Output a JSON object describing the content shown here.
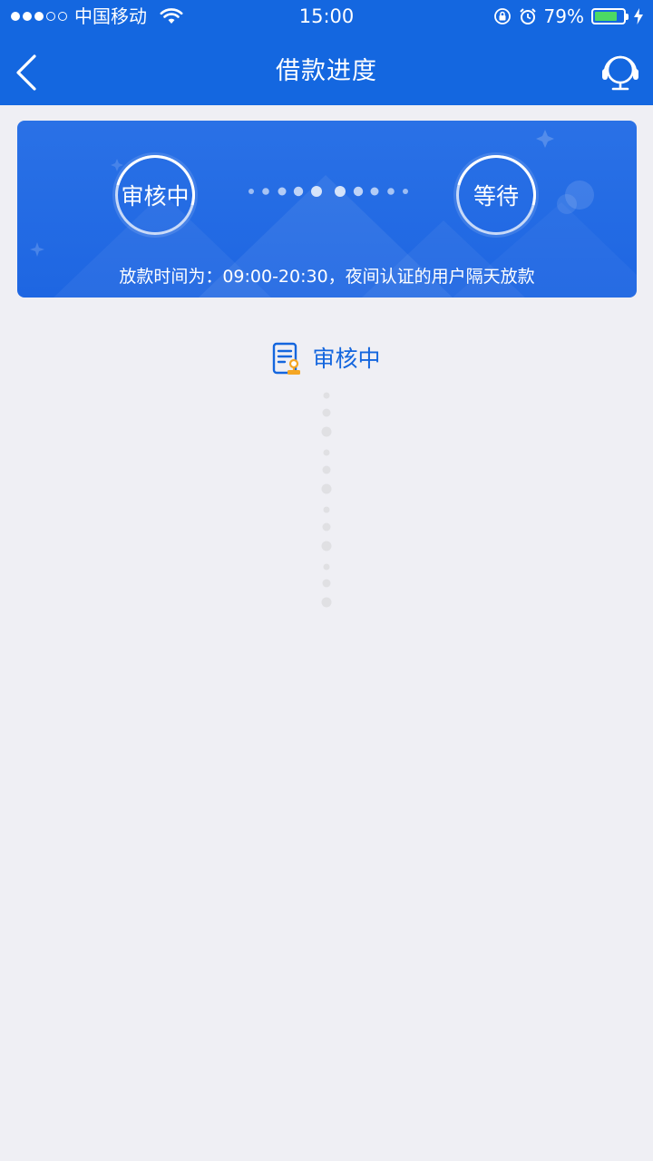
{
  "status_bar": {
    "carrier": "中国移动",
    "time": "15:00",
    "battery_percent": "79%",
    "battery_level": 0.79,
    "signal_bars_filled": 3,
    "signal_bars_total": 5
  },
  "nav": {
    "title": "借款进度",
    "back_icon": "chevron-left-icon",
    "service_icon": "headset-icon"
  },
  "progress_card": {
    "step1_label": "审核中",
    "step2_label": "等待",
    "note": "放款时间为：09:00-20:30，夜间认证的用户隔天放款"
  },
  "status": {
    "icon": "document-stamp-icon",
    "label": "审核中"
  },
  "colors": {
    "primary": "#1467e0",
    "status_text": "#1466de",
    "accent": "#f5a623",
    "background": "#efeff4"
  }
}
